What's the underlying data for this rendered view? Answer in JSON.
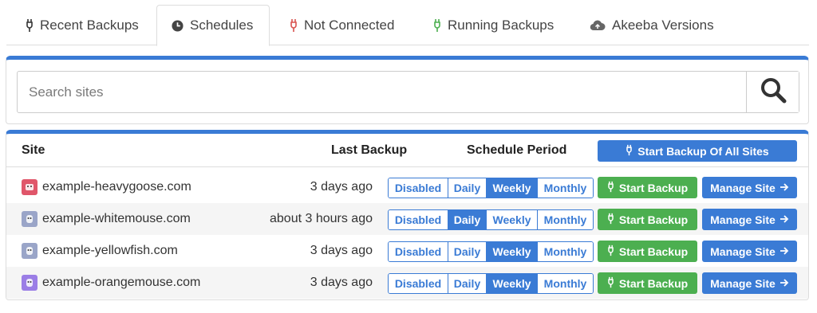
{
  "tabs": [
    {
      "label": "Recent Backups",
      "icon": "plug-icon",
      "active": false
    },
    {
      "label": "Schedules",
      "icon": "clock-icon",
      "active": true
    },
    {
      "label": "Not Connected",
      "icon": "plug-red-icon",
      "active": false
    },
    {
      "label": "Running Backups",
      "icon": "plug-green-icon",
      "active": false
    },
    {
      "label": "Akeeba Versions",
      "icon": "cloud-upload-icon",
      "active": false
    }
  ],
  "search": {
    "placeholder": "Search sites",
    "value": ""
  },
  "table": {
    "headers": {
      "site": "Site",
      "last_backup": "Last Backup",
      "schedule_period": "Schedule Period"
    },
    "start_all_label": "Start Backup Of All Sites",
    "schedule_options": [
      "Disabled",
      "Daily",
      "Weekly",
      "Monthly"
    ],
    "start_backup_label": "Start Backup",
    "manage_site_label": "Manage Site",
    "rows": [
      {
        "site": "example-heavygoose.com",
        "last_backup": "3 days ago",
        "schedule": "Weekly",
        "favicon_color": "#e0566a"
      },
      {
        "site": "example-whitemouse.com",
        "last_backup": "about 3 hours ago",
        "schedule": "Daily",
        "favicon_color": "#9aa5c8"
      },
      {
        "site": "example-yellowfish.com",
        "last_backup": "3 days ago",
        "schedule": "Weekly",
        "favicon_color": "#9aa5c8"
      },
      {
        "site": "example-orangemouse.com",
        "last_backup": "3 days ago",
        "schedule": "Weekly",
        "favicon_color": "#9b7ee6"
      }
    ]
  },
  "colors": {
    "primary": "#3a7bd5",
    "success": "#4caf50",
    "danger": "#d9534f"
  }
}
